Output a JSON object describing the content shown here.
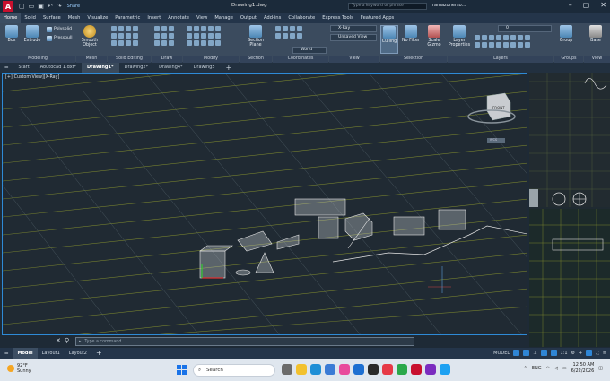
{
  "titlebar": {
    "doc_title": "Drawing1.dwg",
    "share_label": "Share",
    "search_placeholder": "Type a keyword or phrase",
    "user": "ramazonerso..."
  },
  "ribbon_tabs": [
    "Home",
    "Solid",
    "Surface",
    "Mesh",
    "Visualize",
    "Parametric",
    "Insert",
    "Annotate",
    "View",
    "Manage",
    "Output",
    "Add-ins",
    "Collaborate",
    "Express Tools",
    "Featured Apps"
  ],
  "ribbon": {
    "box": "Box",
    "extrude": "Extrude",
    "polysolid": "Polysolid",
    "presspull": "Presspull",
    "smooth_object": "Smooth Object",
    "section_plane": "Section Plane",
    "world": "World",
    "xray": "X-Ray",
    "unsaved_view": "Unsaved View",
    "culling": "Culling",
    "no_filter": "No Filter",
    "scale_gizmo": "Scale Gizmo",
    "layer_properties": "Layer Properties",
    "layer_value": "0",
    "group": "Group",
    "base": "Base",
    "groups": {
      "modeling": "Modeling",
      "mesh": "Mesh",
      "solid_editing": "Solid Editing",
      "draw": "Draw",
      "modify": "Modify",
      "section": "Section",
      "coordinates": "Coordinates",
      "view": "View",
      "selection": "Selection",
      "layers": "Layers",
      "groups_label": "Groups",
      "view2": "View"
    }
  },
  "file_tabs": [
    "Start",
    "Aoutocad 1.dxf*",
    "Drawing1*",
    "Drawing2*",
    "Drawing4*",
    "Drawing5"
  ],
  "active_file_tab": "Drawing1*",
  "viewport": {
    "label": "[+][Custom View][X-Ray]",
    "viewcube_face": "FRONT",
    "wcs": "WCS"
  },
  "command": {
    "placeholder": "Type a command"
  },
  "layout_tabs": [
    "Model",
    "Layout1",
    "Layout2"
  ],
  "status": {
    "model": "MODEL",
    "scale": "1:1"
  },
  "taskbar": {
    "temp": "92°F",
    "weather": "Sunny",
    "search": "Search",
    "lang": "ENG",
    "time": "12:50 AM",
    "date": "6/22/2026"
  },
  "colors": {
    "accent": "#2e8ad6",
    "grid": "#8f9a2e",
    "autocad_red": "#c8102e"
  }
}
